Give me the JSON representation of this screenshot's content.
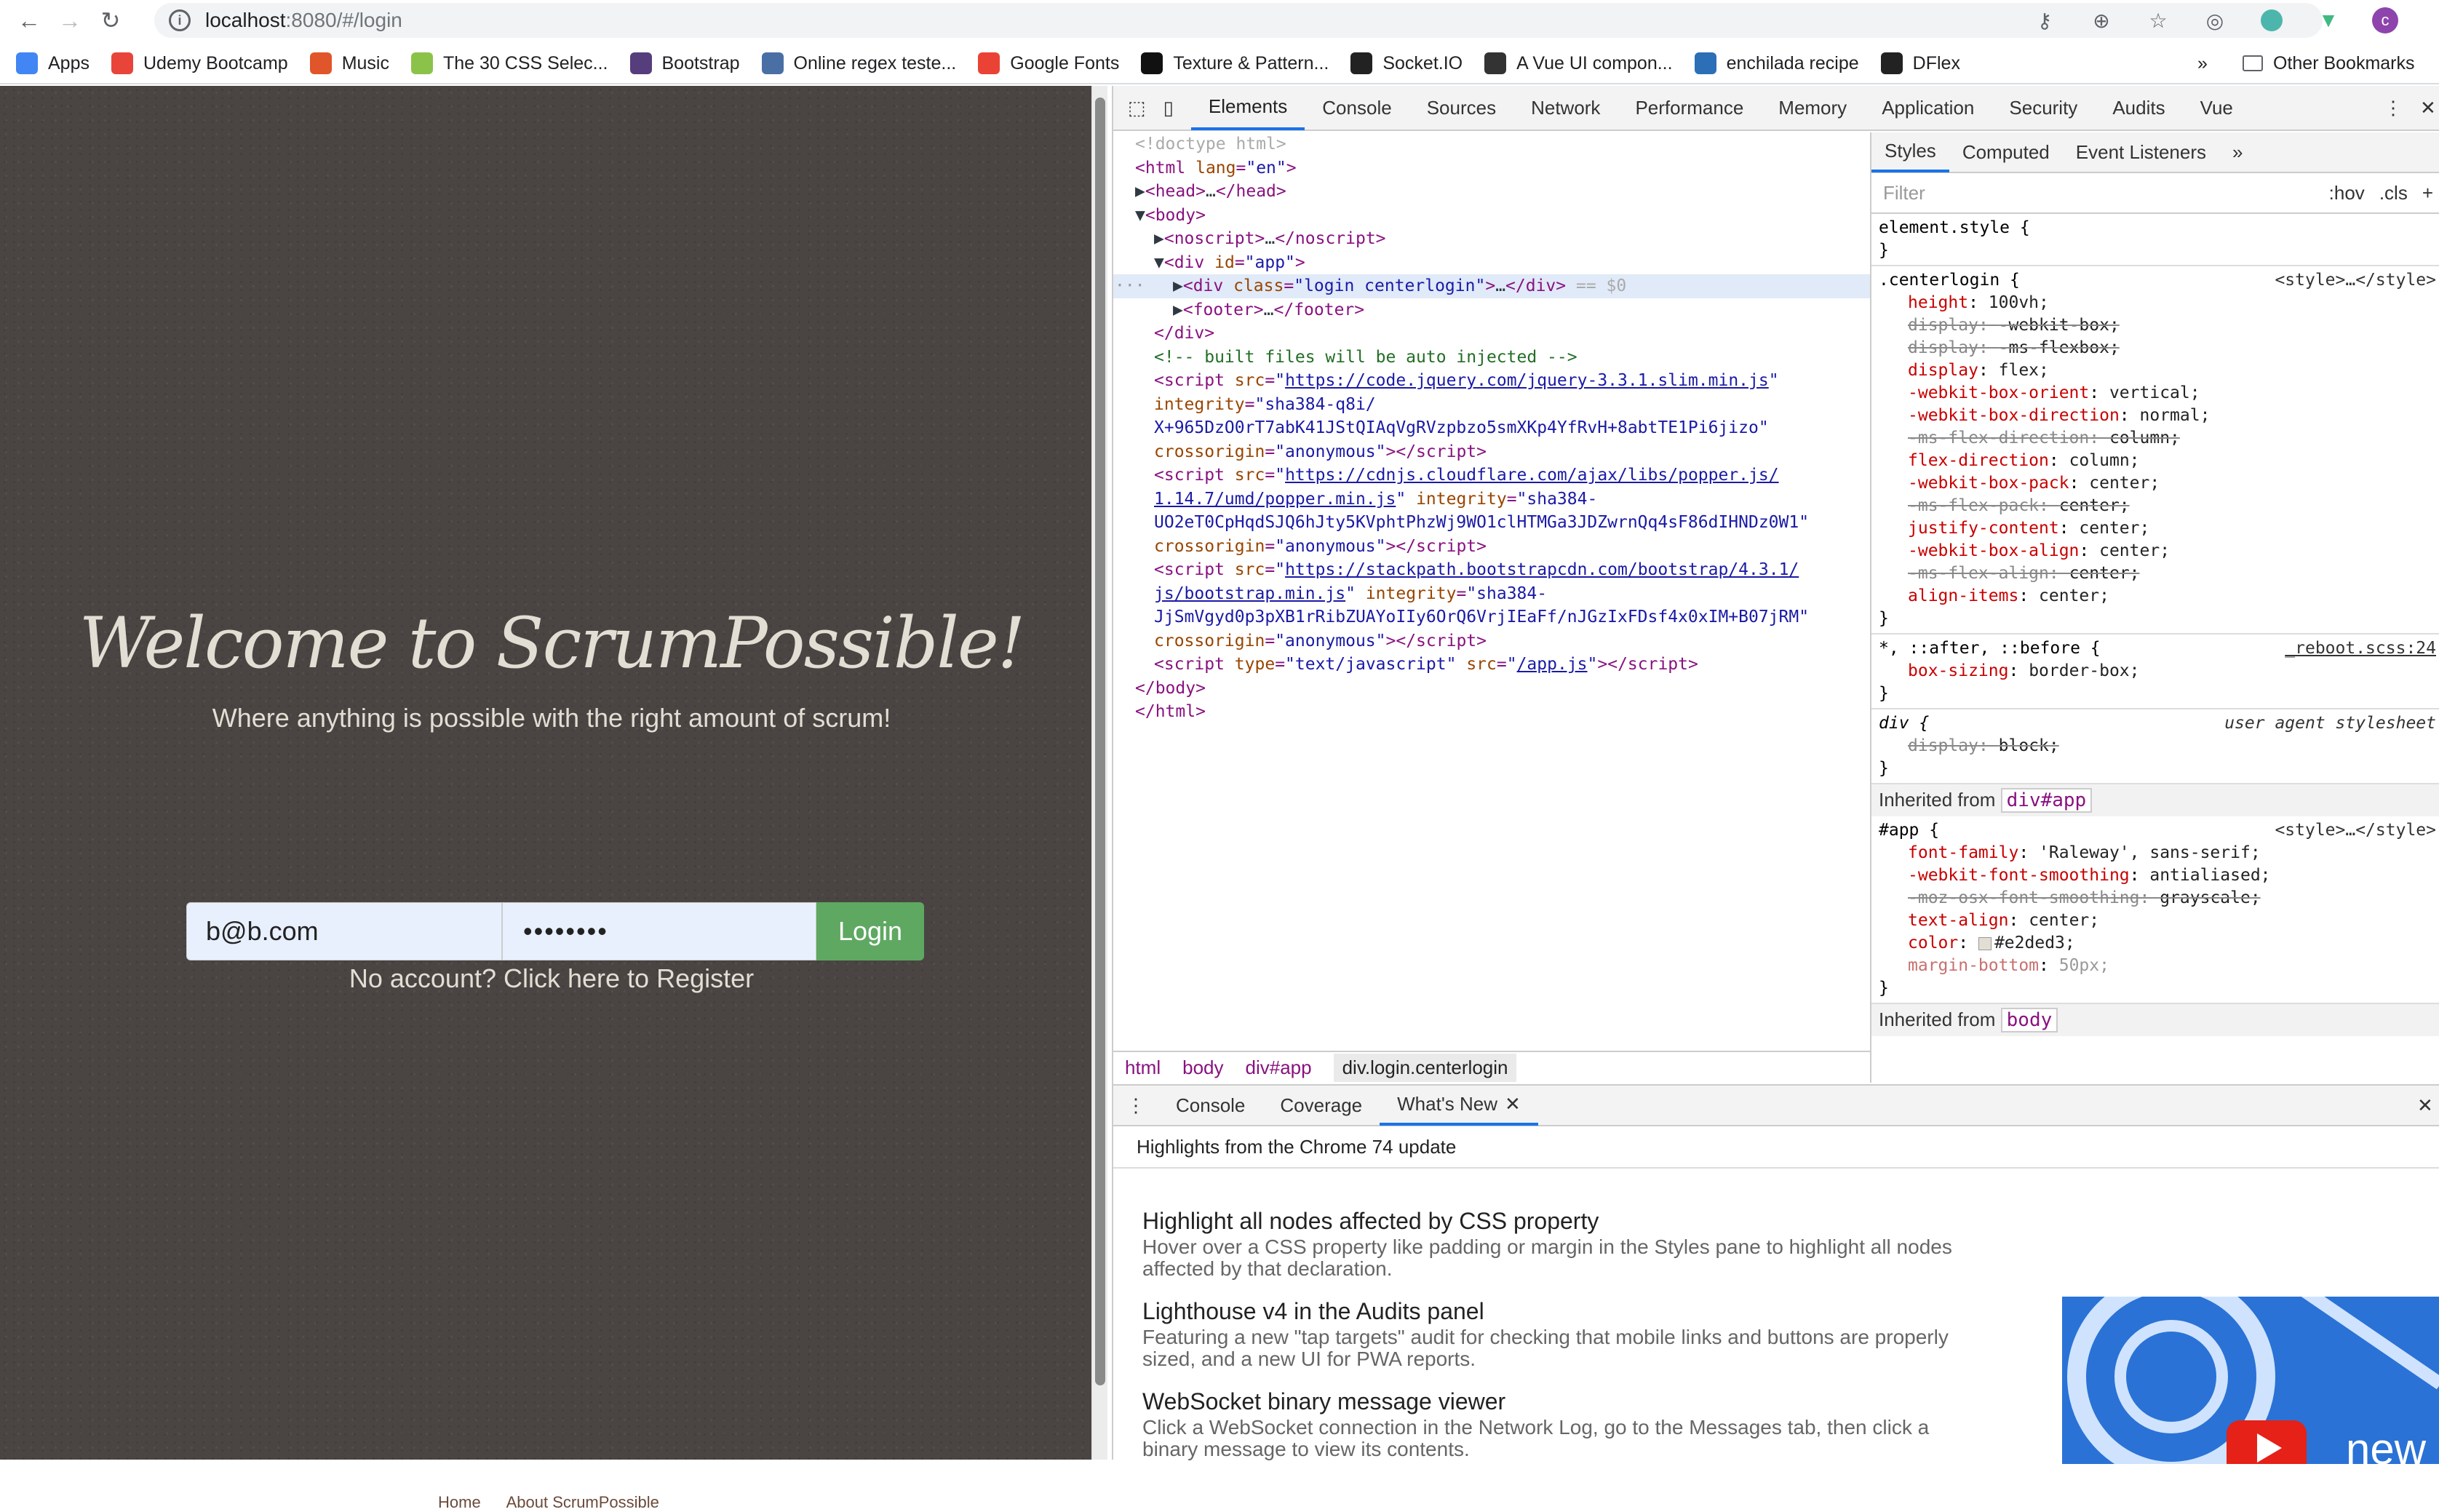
{
  "browser": {
    "url_host": "localhost",
    "url_path": ":8080/#/login",
    "bookmarks": [
      {
        "label": "Apps",
        "color": "#4285f4"
      },
      {
        "label": "Udemy Bootcamp",
        "color": "#e8443a"
      },
      {
        "label": "Music",
        "color": "#e0552a"
      },
      {
        "label": "The 30 CSS Selec...",
        "color": "#8bc34a"
      },
      {
        "label": "Bootstrap",
        "color": "#563d7c"
      },
      {
        "label": "Online regex teste...",
        "color": "#4a6fa5"
      },
      {
        "label": "Google Fonts",
        "color": "#ea4335"
      },
      {
        "label": "Texture & Pattern...",
        "color": "#111111"
      },
      {
        "label": "Socket.IO",
        "color": "#222222"
      },
      {
        "label": "A Vue UI compon...",
        "color": "#333333"
      },
      {
        "label": "enchilada recipe",
        "color": "#2c6fb7"
      },
      {
        "label": "DFlex",
        "color": "#222222"
      }
    ],
    "bookmarks_more": "»",
    "other_bookmarks": "Other Bookmarks",
    "profile_letter": "c"
  },
  "login_page": {
    "title": "Welcome to ScrumPossible!",
    "tagline": "Where anything is possible with the right amount of scrum!",
    "email_value": "b@b.com",
    "password_value": "••••••••",
    "login_button": "Login",
    "register_link": "No account? Click here to Register",
    "footer_links": [
      "Home",
      "About ScrumPossible"
    ]
  },
  "devtools": {
    "tabs": [
      "Elements",
      "Console",
      "Sources",
      "Network",
      "Performance",
      "Memory",
      "Application",
      "Security",
      "Audits",
      "Vue"
    ],
    "active_tab": "Elements",
    "dom_lines": [
      {
        "html": "<span class='gr'>&lt;!doctype html&gt;</span>",
        "indent": 0
      },
      {
        "html": "<span class='tag'>&lt;html</span> <span class='at'>lang</span>=<span class='av'>\"en\"</span><span class='tag'>&gt;</span>",
        "indent": 0
      },
      {
        "html": "<span class='bk'>▶</span><span class='tag'>&lt;head&gt;</span><span class='bk'>…</span><span class='tag'>&lt;/head&gt;</span>",
        "indent": 0
      },
      {
        "html": "<span class='bk'>▼</span><span class='tag'>&lt;body&gt;</span>",
        "indent": 0
      },
      {
        "html": "<span class='bk'>▶</span><span class='tag'>&lt;noscript&gt;</span><span class='bk'>…</span><span class='tag'>&lt;/noscript&gt;</span>",
        "indent": 1
      },
      {
        "html": "<span class='bk'>▼</span><span class='tag'>&lt;div</span> <span class='at'>id</span>=<span class='av'>\"app\"</span><span class='tag'>&gt;</span>",
        "indent": 1
      },
      {
        "html": "<span class='bk'>▶</span><span class='tag'>&lt;div</span> <span class='at'>class</span>=<span class='av'>\"login centerlogin\"</span><span class='tag'>&gt;</span><span class='bk'>…</span><span class='tag'>&lt;/div&gt;</span> <span class='gr'>== $0</span>",
        "indent": 2,
        "selected": true
      },
      {
        "html": "<span class='bk'>▶</span><span class='tag'>&lt;footer&gt;</span><span class='bk'>…</span><span class='tag'>&lt;/footer&gt;</span>",
        "indent": 2
      },
      {
        "html": "<span class='tag'>&lt;/div&gt;</span>",
        "indent": 1
      },
      {
        "html": "<span class='cm'>&lt;!-- built files will be auto injected --&gt;</span>",
        "indent": 1
      },
      {
        "html": "<span class='tag'>&lt;script</span> <span class='at'>src</span>=<span class='av'>\"</span><span class='lnk'>https://code.jquery.com/jquery-3.3.1.slim.min.js</span><span class='av'>\"</span>",
        "indent": 1
      },
      {
        "html": "<span class='at'>integrity</span>=<span class='av'>\"sha384-q8i/</span>",
        "indent": 1
      },
      {
        "html": "<span class='av'>X+965DzO0rT7abK41JStQIAqVgRVzpbzo5smXKp4YfRvH+8abtTE1Pi6jizo\"</span>",
        "indent": 1
      },
      {
        "html": "<span class='at'>crossorigin</span>=<span class='av'>\"anonymous\"</span><span class='tag'>&gt;&lt;/script&gt;</span>",
        "indent": 1
      },
      {
        "html": "<span class='tag'>&lt;script</span> <span class='at'>src</span>=<span class='av'>\"</span><span class='lnk'>https://cdnjs.cloudflare.com/ajax/libs/popper.js/</span>",
        "indent": 1
      },
      {
        "html": "<span class='lnk'>1.14.7/umd/popper.min.js</span><span class='av'>\"</span> <span class='at'>integrity</span>=<span class='av'>\"sha384-</span>",
        "indent": 1
      },
      {
        "html": "<span class='av'>UO2eT0CpHqdSJQ6hJty5KVphtPhzWj9WO1clHTMGa3JDZwrnQq4sF86dIHNDz0W1\"</span>",
        "indent": 1
      },
      {
        "html": "<span class='at'>crossorigin</span>=<span class='av'>\"anonymous\"</span><span class='tag'>&gt;&lt;/script&gt;</span>",
        "indent": 1
      },
      {
        "html": "<span class='tag'>&lt;script</span> <span class='at'>src</span>=<span class='av'>\"</span><span class='lnk'>https://stackpath.bootstrapcdn.com/bootstrap/4.3.1/</span>",
        "indent": 1
      },
      {
        "html": "<span class='lnk'>js/bootstrap.min.js</span><span class='av'>\"</span> <span class='at'>integrity</span>=<span class='av'>\"sha384-</span>",
        "indent": 1
      },
      {
        "html": "<span class='av'>JjSmVgyd0p3pXB1rRibZUAYoIIy6OrQ6VrjIEaFf/nJGzIxFDsf4x0xIM+B07jRM\"</span>",
        "indent": 1
      },
      {
        "html": "<span class='at'>crossorigin</span>=<span class='av'>\"anonymous\"</span><span class='tag'>&gt;&lt;/script&gt;</span>",
        "indent": 1
      },
      {
        "html": "<span class='tag'>&lt;script</span> <span class='at'>type</span>=<span class='av'>\"text/javascript\"</span> <span class='at'>src</span>=<span class='av'>\"</span><span class='lnk'>/app.js</span><span class='av'>\"</span><span class='tag'>&gt;&lt;/script&gt;</span>",
        "indent": 1
      },
      {
        "html": "<span class='tag'>&lt;/body&gt;</span>",
        "indent": 0
      },
      {
        "html": "<span class='tag'>&lt;/html&gt;</span>",
        "indent": 0
      }
    ],
    "breadcrumbs": [
      "html",
      "body",
      "div#app",
      "div.login.centerlogin"
    ],
    "styles_tabs": [
      "Styles",
      "Computed",
      "Event Listeners"
    ],
    "filter_placeholder": "Filter",
    "hov": ":hov",
    "cls": ".cls",
    "element_style": "element.style {",
    "rules": [
      {
        "selector": ".centerlogin {",
        "source": "<style>…</style>",
        "props": [
          {
            "n": "height",
            "v": "100vh;",
            "s": false
          },
          {
            "n": "display",
            "v": "-webkit-box;",
            "s": true
          },
          {
            "n": "display",
            "v": "-ms-flexbox;",
            "s": true
          },
          {
            "n": "display",
            "v": "flex;",
            "s": false
          },
          {
            "n": "-webkit-box-orient",
            "v": "vertical;",
            "s": false
          },
          {
            "n": "-webkit-box-direction",
            "v": "normal;",
            "s": false
          },
          {
            "n": "-ms-flex-direction",
            "v": "column;",
            "s": true
          },
          {
            "n": "flex-direction",
            "v": "column;",
            "s": false
          },
          {
            "n": "-webkit-box-pack",
            "v": "center;",
            "s": false
          },
          {
            "n": "-ms-flex-pack",
            "v": "center;",
            "s": true
          },
          {
            "n": "justify-content",
            "v": "center;",
            "s": false
          },
          {
            "n": "-webkit-box-align",
            "v": "center;",
            "s": false
          },
          {
            "n": "-ms-flex-align",
            "v": "center;",
            "s": true
          },
          {
            "n": "align-items",
            "v": "center;",
            "s": false
          }
        ]
      },
      {
        "selector": "*, ::after, ::before {",
        "source": "_reboot.scss:24",
        "props": [
          {
            "n": "box-sizing",
            "v": "border-box;",
            "s": false
          }
        ]
      },
      {
        "selector": "div {",
        "source": "user agent stylesheet",
        "props": [
          {
            "n": "display",
            "v": "block;",
            "s": true
          }
        ]
      }
    ],
    "inherited_app": "Inherited from",
    "inherited_app_box": "div#app",
    "app_rule": {
      "selector": "#app {",
      "source": "<style>…</style>",
      "props": [
        {
          "n": "font-family",
          "v": "'Raleway', sans-serif;",
          "s": false
        },
        {
          "n": "-webkit-font-smoothing",
          "v": "antialiased;",
          "s": false
        },
        {
          "n": "-moz-osx-font-smoothing",
          "v": "grayscale;",
          "s": true
        },
        {
          "n": "text-align",
          "v": "center;",
          "s": false
        },
        {
          "n": "color",
          "v": "#e2ded3;",
          "s": false
        },
        {
          "n": "margin-bottom",
          "v": "50px;",
          "s": false
        }
      ]
    },
    "inherited_body": "Inherited from",
    "inherited_body_box": "body",
    "drawer_tabs": [
      "Console",
      "Coverage",
      "What's New"
    ],
    "highlights_title": "Highlights from the Chrome 74 update",
    "news": [
      {
        "title": "Highlight all nodes affected by CSS property",
        "body": "Hover over a CSS property like padding or margin in the Styles pane to highlight all nodes affected by that declaration."
      },
      {
        "title": "Lighthouse v4 in the Audits panel",
        "body": "Featuring a new \"tap targets\" audit for checking that mobile links and buttons are properly sized, and a new UI for PWA reports."
      },
      {
        "title": "WebSocket binary message viewer",
        "body": "Click a WebSocket connection in the Network Log, go to the Messages tab, then click a binary message to view its contents."
      }
    ],
    "promo_text": "new"
  }
}
